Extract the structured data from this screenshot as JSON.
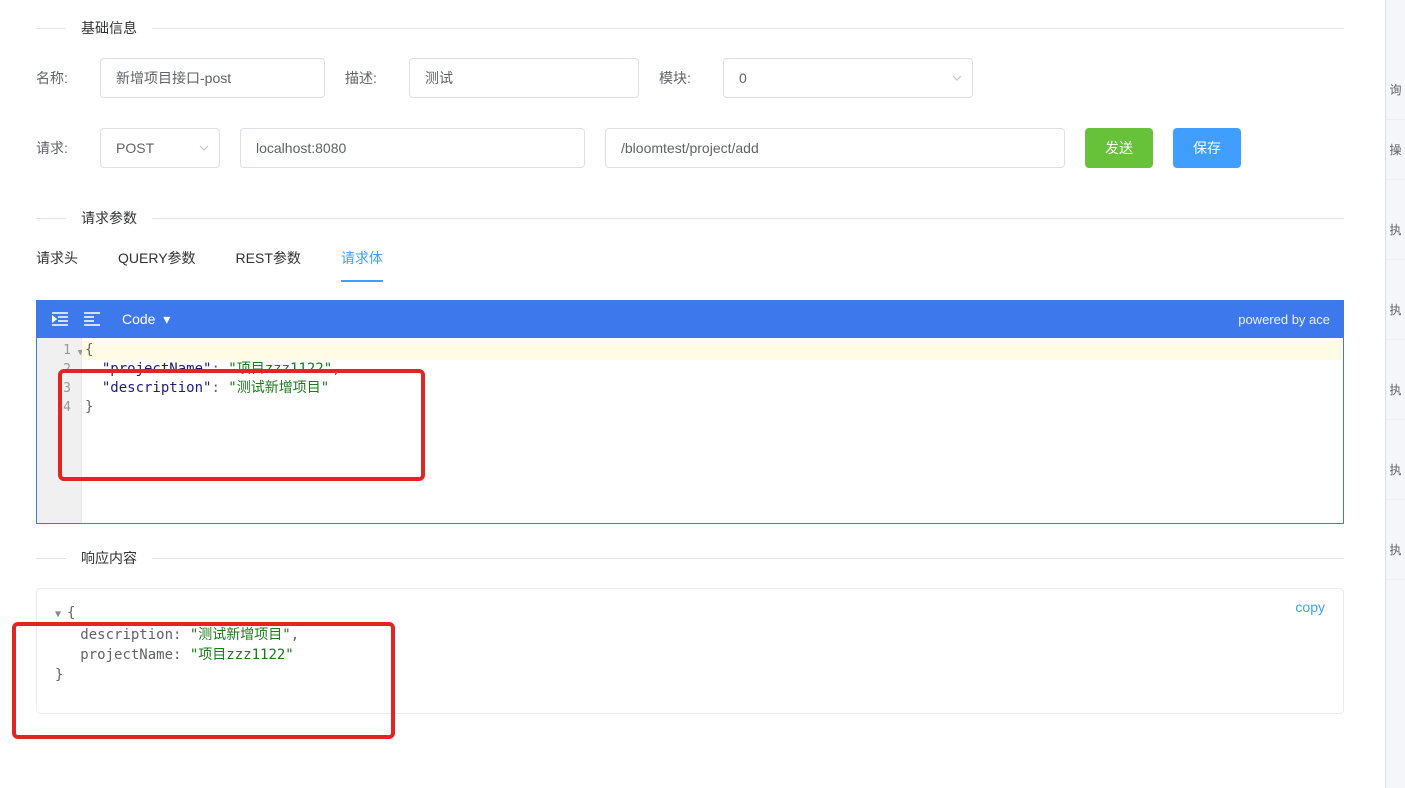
{
  "sections": {
    "basic_info": "基础信息",
    "request_params": "请求参数",
    "response_content": "响应内容"
  },
  "form": {
    "name_label": "名称:",
    "name_value": "新增项目接口-post",
    "desc_label": "描述:",
    "desc_value": "测试",
    "module_label": "模块:",
    "module_value": "0",
    "request_label": "请求:",
    "method": "POST",
    "host": "localhost:8080",
    "path": "/bloomtest/project/add"
  },
  "buttons": {
    "send": "发送",
    "save": "保存"
  },
  "tabs": {
    "headers": "请求头",
    "query": "QUERY参数",
    "rest": "REST参数",
    "body": "请求体"
  },
  "editor": {
    "code_label": "Code",
    "powered": "powered by ace",
    "lines": {
      "l1": "{",
      "l2_key": "\"projectName\"",
      "l2_sep": ": ",
      "l2_val": "\"项目zzz1122\"",
      "l2_end": ",",
      "l3_key": "\"description\"",
      "l3_sep": ": ",
      "l3_val": "\"测试新增项目\"",
      "l4": "}"
    },
    "gutter": [
      "1",
      "2",
      "3",
      "4"
    ]
  },
  "response": {
    "copy": "copy",
    "brace_open": "{",
    "r1_key": "description",
    "r1_sep": ": ",
    "r1_val": "\"测试新增项目\"",
    "r1_end": ",",
    "r2_key": "projectName",
    "r2_sep": ": ",
    "r2_val": "\"项目zzz1122\"",
    "brace_close": "}"
  },
  "side": {
    "s1": "询",
    "s2": "操",
    "s3": "执",
    "s4": "执",
    "s5": "执",
    "s6": "执",
    "s7": "执"
  }
}
